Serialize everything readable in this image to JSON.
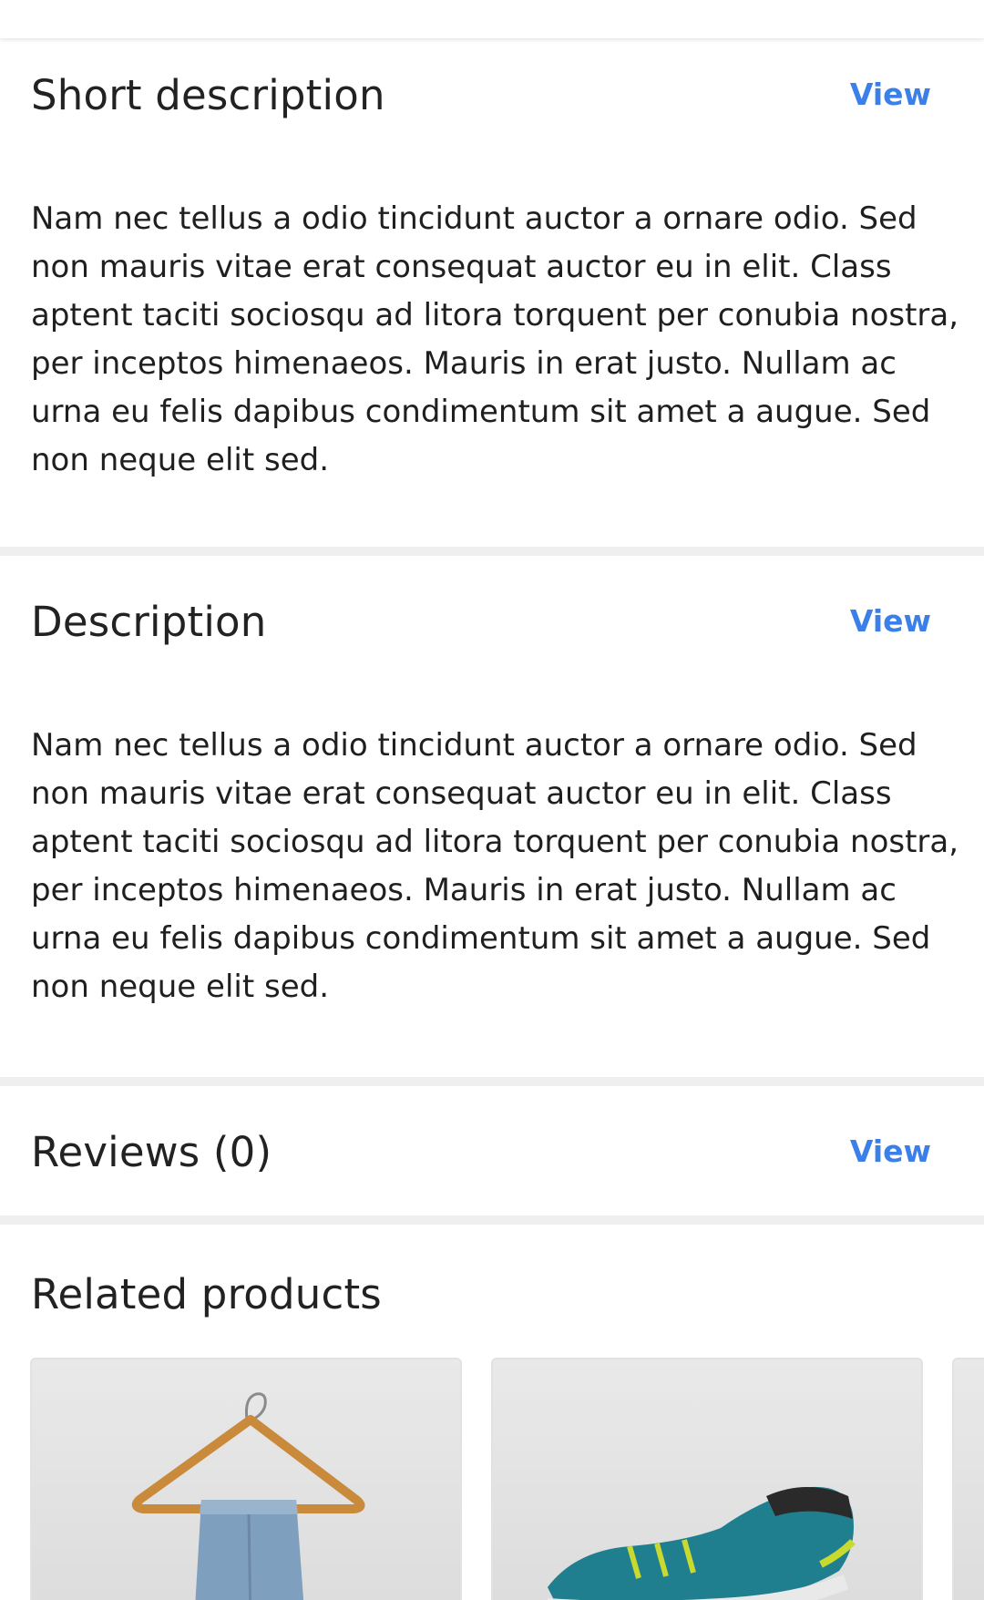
{
  "sections": {
    "short_description": {
      "title": "Short description",
      "view_label": "View",
      "body": "Nam nec tellus a odio tincidunt auctor a ornare odio. Sed non mauris vitae erat consequat auctor eu in elit. Class aptent taciti sociosqu ad litora torquent per conubia nostra, per inceptos himenaeos. Mauris in erat justo. Nullam ac urna eu felis dapibus condimentum sit amet a augue. Sed non neque elit sed."
    },
    "description": {
      "title": "Description",
      "view_label": "View",
      "body": "Nam nec tellus a odio tincidunt auctor a ornare odio. Sed non mauris vitae erat consequat auctor eu in elit. Class aptent taciti sociosqu ad litora torquent per conubia nostra, per inceptos himenaeos. Mauris in erat justo. Nullam ac urna eu felis dapibus condimentum sit amet a augue. Sed non neque elit sed."
    },
    "reviews": {
      "title": "Reviews (0)",
      "view_label": "View"
    }
  },
  "related": {
    "title": "Related products",
    "products": [
      {
        "image": "jeans-on-hanger"
      },
      {
        "image": "teal-sneaker"
      },
      {
        "image": "product-partial"
      }
    ]
  },
  "colors": {
    "link": "#3a80e8",
    "separator": "#efefef",
    "text": "#1f1f1f"
  }
}
